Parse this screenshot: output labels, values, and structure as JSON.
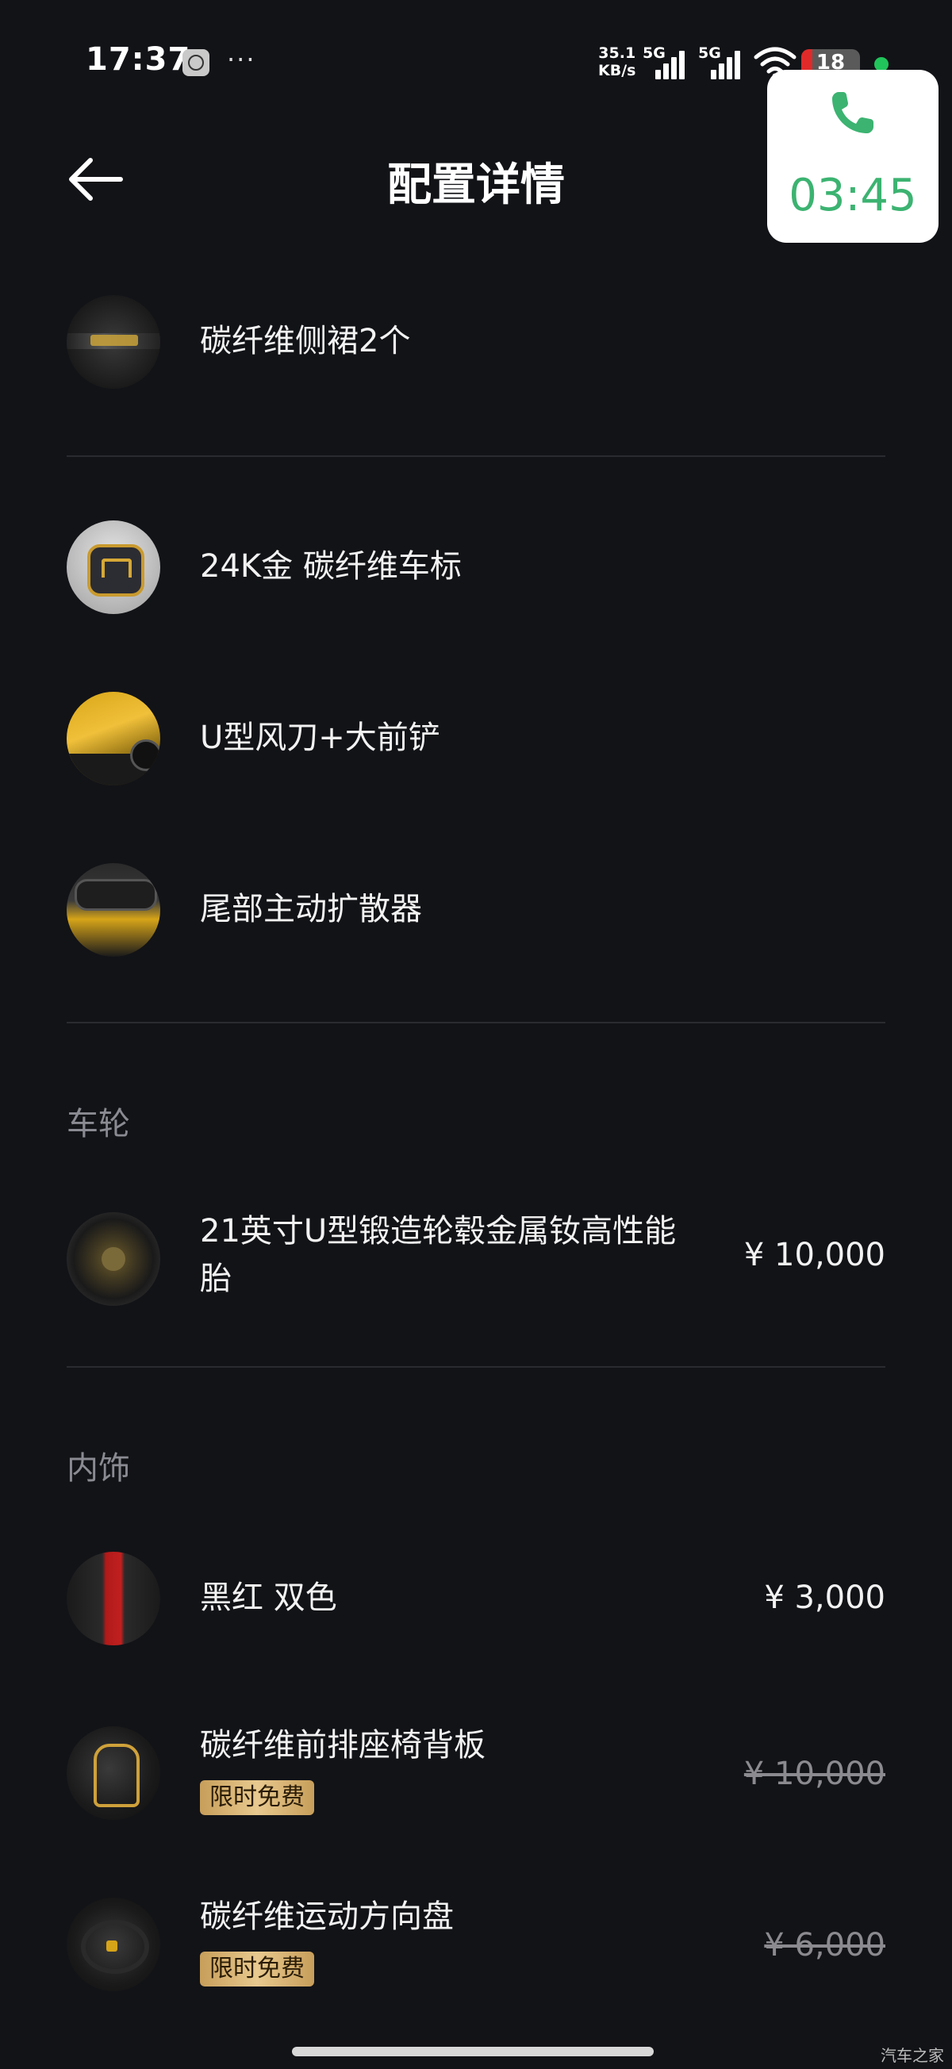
{
  "status_bar": {
    "time": "17:37",
    "more": "···",
    "net_speed_value": "35.1",
    "net_speed_unit": "KB/s",
    "signal1_label": "5G",
    "signal2_label": "5G",
    "battery": "18"
  },
  "call": {
    "duration": "03:45",
    "icon": "phone-icon",
    "color": "#3cb371"
  },
  "header": {
    "title": "配置详情",
    "back_icon": "arrow-left-icon"
  },
  "groups": [
    {
      "items": [
        {
          "label": "碳纤维侧裙2个",
          "price": ""
        }
      ]
    },
    {
      "items": [
        {
          "label": "24K金 碳纤维车标",
          "price": ""
        },
        {
          "label": "U型风刀+大前铲",
          "price": ""
        },
        {
          "label": "尾部主动扩散器",
          "price": ""
        }
      ]
    }
  ],
  "wheels": {
    "section": "车轮",
    "items": [
      {
        "label_line1": "21英寸U型锻造轮毂金属钕高性能",
        "label_line2": "胎",
        "price": "¥ 10,000"
      }
    ]
  },
  "interior": {
    "section": "内饰",
    "items": [
      {
        "label": "黑红 双色",
        "price": "¥ 3,000"
      },
      {
        "label": "碳纤维前排座椅背板",
        "badge": "限时免费",
        "price": "¥ 10,000",
        "price_struck": true
      },
      {
        "label": "碳纤维运动方向盘",
        "badge": "限时免费",
        "price": "¥ 6,000",
        "price_struck": true
      }
    ]
  },
  "watermark": "汽车之家",
  "colors": {
    "background": "#121317",
    "badge_gold": "#d9b572",
    "section_text": "#8a8b92"
  }
}
